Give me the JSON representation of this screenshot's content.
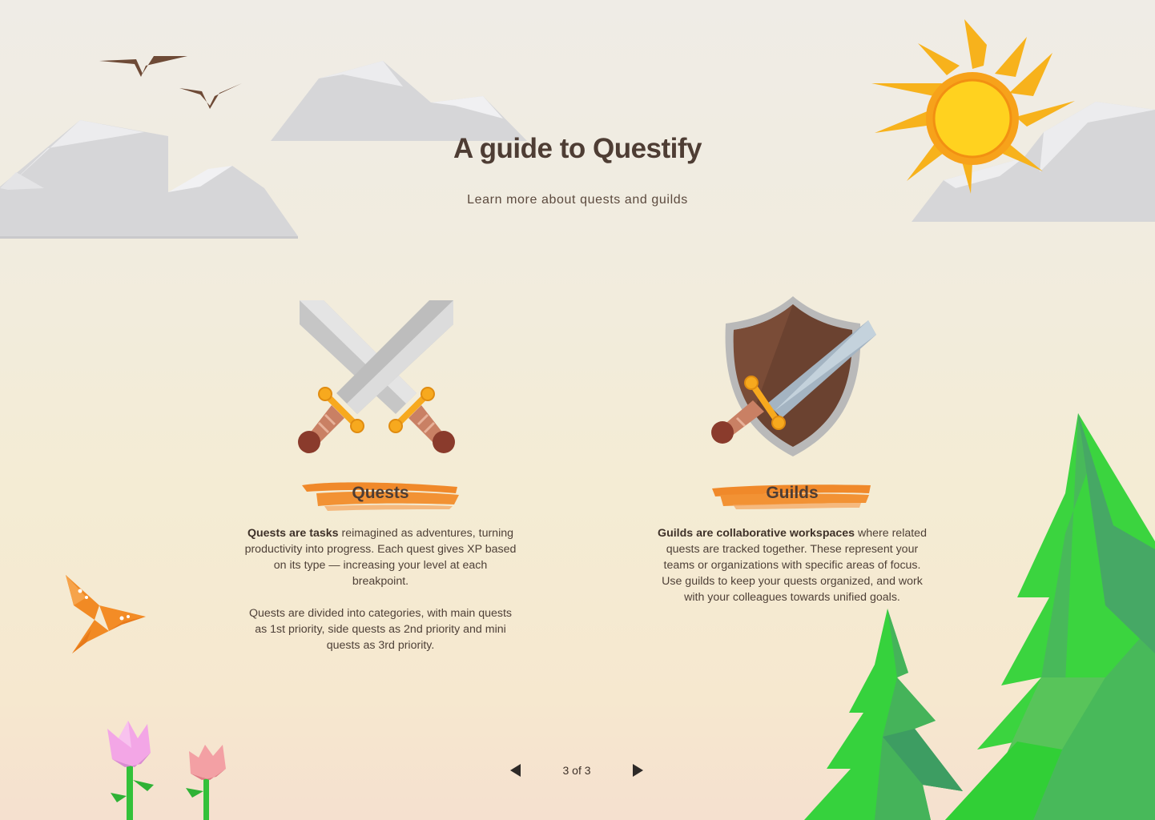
{
  "header": {
    "title": "A guide to Questify",
    "subtitle": "Learn more about quests and guilds"
  },
  "cards": [
    {
      "icon": "crossed-swords-icon",
      "label": "Quests",
      "lead": "Quests are tasks",
      "text": " reimagined as adventures, turning productivity into progress. Each quest gives XP based on its type — increasing your level at each breakpoint.\n\nQuests are divided into categories, with main quests as 1st priority, side quests as 2nd priority and mini quests as 3rd priority."
    },
    {
      "icon": "shield-sword-icon",
      "label": "Guilds",
      "lead": "Guilds are collaborative workspaces",
      "text": " where related quests are tracked together. These represent your teams or organizations with specific areas of focus. Use guilds to keep your quests organized, and work with your colleagues towards unified goals."
    }
  ],
  "pager": {
    "text": "3 of 3",
    "prev_icon": "triangle-left-icon",
    "next_icon": "triangle-right-icon"
  },
  "colors": {
    "accent_orange": "#f0892a",
    "title_brown": "#4e3d34",
    "tree_green": "#3fc94a"
  }
}
